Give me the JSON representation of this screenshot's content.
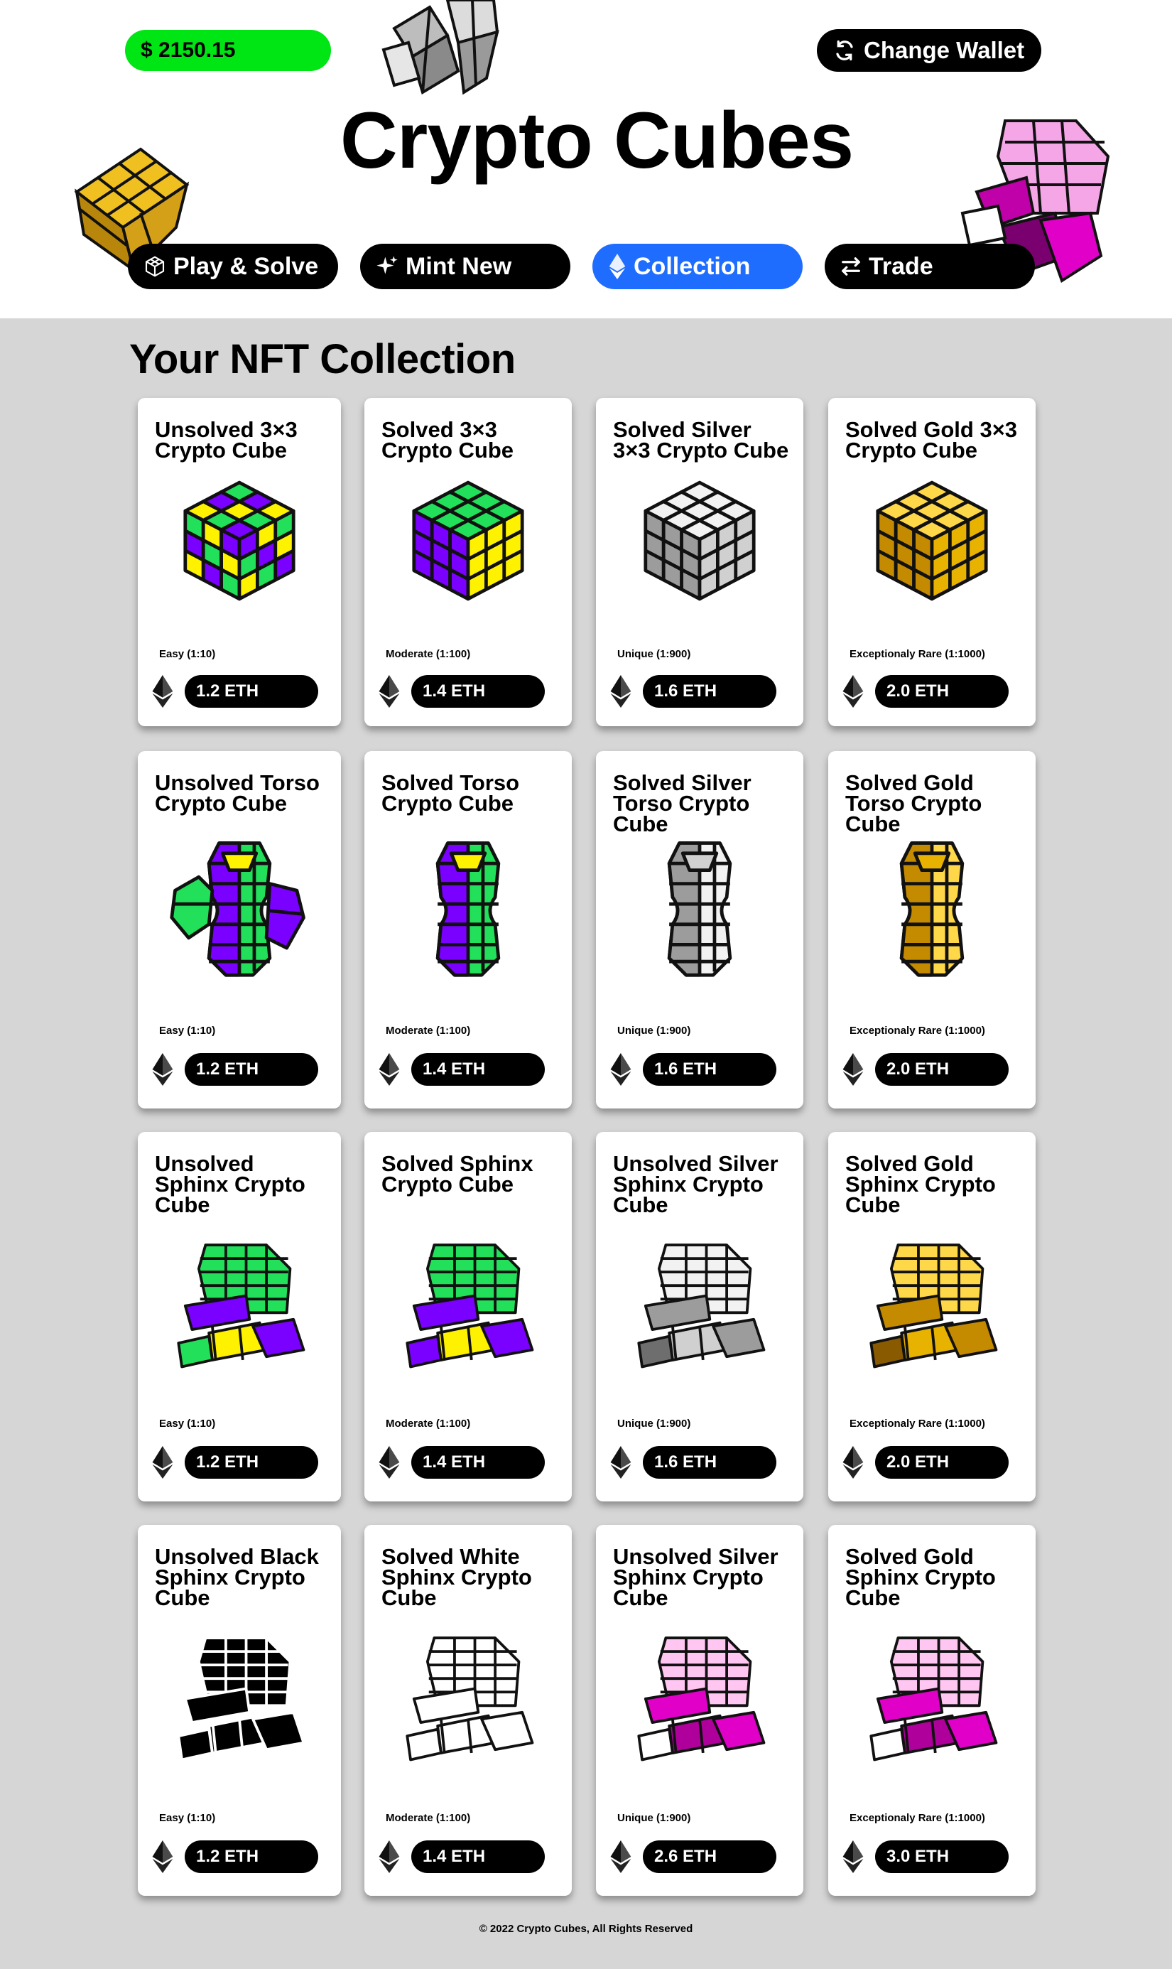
{
  "header": {
    "balance": "$ 2150.15",
    "wallet_label": "Change Wallet",
    "title": "Crypto Cubes"
  },
  "nav": [
    {
      "label": "Play & Solve",
      "icon": "cube-icon",
      "active": false
    },
    {
      "label": "Mint New",
      "icon": "sparkle-icon",
      "active": false
    },
    {
      "label": "Collection",
      "icon": "ethereum-icon",
      "active": true
    },
    {
      "label": "Trade",
      "icon": "swap-icon",
      "active": false
    }
  ],
  "collection_title": "Your NFT Collection",
  "colors": {
    "balance_green": "#00e514",
    "active_blue": "#1f6dff",
    "green": "#22e05a",
    "purple": "#7a00ff",
    "yellow": "#fff200",
    "silver": "#b8b8b8",
    "gold": "#d9a400",
    "pink": "#e000c8"
  },
  "rows": [
    [
      {
        "title": "Unsolved 3×3 Crypto Cube",
        "rarity": "Easy (1:10)",
        "price": "1.2 ETH",
        "art": "cube-unsolved-icon"
      },
      {
        "title": "Solved 3×3 Crypto Cube",
        "rarity": "Moderate (1:100)",
        "price": "1.4 ETH",
        "art": "cube-solved-icon"
      },
      {
        "title": "Solved Silver 3×3 Crypto Cube",
        "rarity": "Unique (1:900)",
        "price": "1.6 ETH",
        "art": "cube-silver-icon"
      },
      {
        "title": "Solved Gold 3×3 Crypto Cube",
        "rarity": "Exceptionaly Rare (1:1000)",
        "price": "2.0 ETH",
        "art": "cube-gold-icon"
      }
    ],
    [
      {
        "title": "Unsolved Torso Crypto Cube",
        "rarity": "Easy (1:10)",
        "price": "1.2 ETH",
        "art": "torso-unsolved-icon"
      },
      {
        "title": "Solved Torso Crypto Cube",
        "rarity": "Moderate (1:100)",
        "price": "1.4 ETH",
        "art": "torso-solved-icon"
      },
      {
        "title": "Solved Silver Torso Crypto Cube",
        "rarity": "Unique (1:900)",
        "price": "1.6 ETH",
        "art": "torso-silver-icon"
      },
      {
        "title": "Solved Gold Torso Crypto Cube",
        "rarity": "Exceptionaly Rare (1:1000)",
        "price": "2.0 ETH",
        "art": "torso-gold-icon"
      }
    ],
    [
      {
        "title": "Unsolved Sphinx Crypto Cube",
        "rarity": "Easy (1:10)",
        "price": "1.2 ETH",
        "art": "sphinx-unsolved-icon"
      },
      {
        "title": "Solved Sphinx Crypto Cube",
        "rarity": "Moderate (1:100)",
        "price": "1.4 ETH",
        "art": "sphinx-solved-icon"
      },
      {
        "title": "Unsolved Silver Sphinx Crypto Cube",
        "rarity": "Unique (1:900)",
        "price": "1.6 ETH",
        "art": "sphinx-silver-icon"
      },
      {
        "title": "Solved Gold Sphinx Crypto Cube",
        "rarity": "Exceptionaly Rare (1:1000)",
        "price": "2.0 ETH",
        "art": "sphinx-gold-icon"
      }
    ],
    [
      {
        "title": "Unsolved Black Sphinx Crypto Cube",
        "rarity": "Easy (1:10)",
        "price": "1.2 ETH",
        "art": "sphinx-black-icon"
      },
      {
        "title": "Solved White Sphinx Crypto Cube",
        "rarity": "Moderate (1:100)",
        "price": "1.4 ETH",
        "art": "sphinx-white-icon"
      },
      {
        "title": "Unsolved Silver Sphinx Crypto Cube",
        "rarity": "Unique (1:900)",
        "price": "2.6 ETH",
        "art": "sphinx-pink-icon"
      },
      {
        "title": "Solved Gold Sphinx Crypto Cube",
        "rarity": "Exceptionaly Rare (1:1000)",
        "price": "3.0 ETH",
        "art": "sphinx-pink-gold-icon"
      }
    ]
  ],
  "footer": "© 2022 Crypto Cubes, All Rights Reserved"
}
